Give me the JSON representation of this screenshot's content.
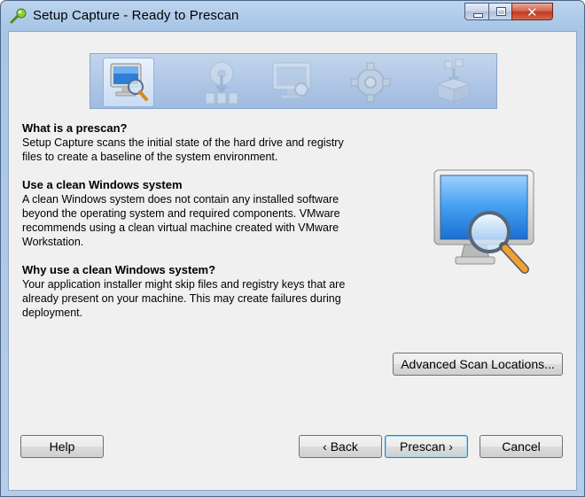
{
  "window": {
    "title": "Setup Capture - Ready to Prescan",
    "controls": {
      "minimize_icon": "minimize-icon",
      "maximize_icon": "maximize-icon",
      "close_icon": "close-icon",
      "close_glyph": "✕"
    }
  },
  "banner": {
    "steps": [
      {
        "icon": "monitor-magnifier-icon",
        "active": true
      },
      {
        "icon": "disc-install-icon",
        "active": false
      },
      {
        "icon": "monitor-icon",
        "active": false
      },
      {
        "icon": "gear-icon",
        "active": false
      },
      {
        "icon": "package-box-icon",
        "active": false
      }
    ]
  },
  "content": {
    "sections": [
      {
        "heading": "What is a prescan?",
        "lines": [
          "Setup Capture scans the initial state of the hard drive and registry",
          "files to create a baseline of the system environment."
        ]
      },
      {
        "heading": "Use a clean Windows system",
        "lines": [
          "A clean Windows system does not contain any installed software",
          "beyond the operating system and required components. VMware",
          "recommends using a clean virtual machine created with VMware",
          "Workstation."
        ]
      },
      {
        "heading": "Why use a clean Windows system?",
        "lines": [
          "Your application installer might skip files and registry keys that are",
          "already present on your machine. This may create failures during",
          "deployment."
        ]
      }
    ],
    "illustration_icon": "monitor-scan-icon"
  },
  "buttons": {
    "advanced": "Advanced Scan Locations...",
    "help": "Help",
    "back": "‹ Back",
    "prescan": "Prescan ›",
    "cancel": "Cancel"
  }
}
